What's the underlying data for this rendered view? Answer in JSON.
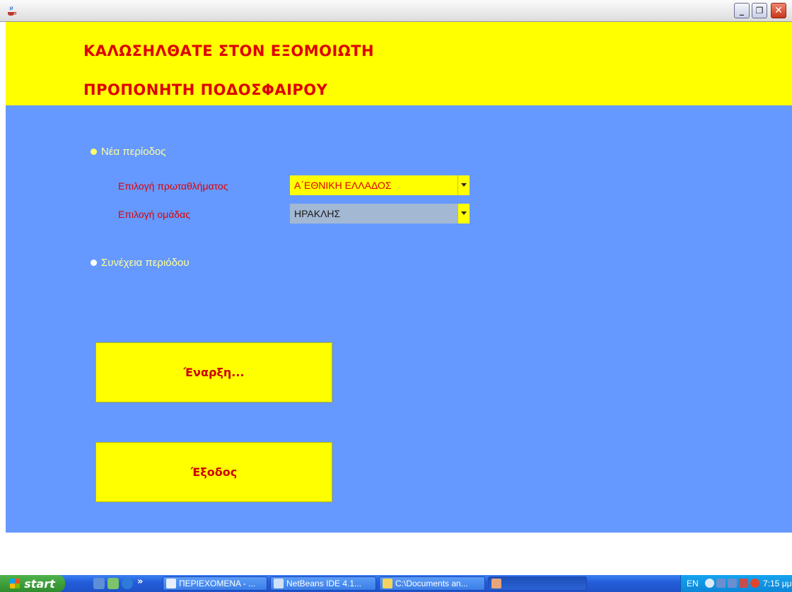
{
  "window": {
    "minimize_symbol": "_",
    "maximize_symbol": "❐",
    "close_symbol": "✕"
  },
  "header": {
    "line1": "ΚΑΛΩΣΗΛΘΑΤΕ ΣΤΟΝ ΕΞΟΜΟΙΩΤΗ",
    "line2": "ΠΡΟΠΟΝΗΤΗ ΠΟΔΟΣΦΑΙΡΟΥ"
  },
  "options": {
    "new_season": "Νέα περίοδος",
    "continue_season": "Συνέχεια περιόδου",
    "selected": "new_season"
  },
  "form": {
    "league_label": "Επιλογή πρωταθλήματος",
    "league_value": "Α΄ΕΘΝΙΚΗ ΕΛΛΑΔΟΣ",
    "team_label": "Επιλογή ομάδας",
    "team_value": "ΗΡΑΚΛΗΣ"
  },
  "buttons": {
    "start": "Έναρξη...",
    "exit": "Έξοδος"
  },
  "taskbar": {
    "start_label": "start",
    "overflow": "»",
    "items": [
      "ΠΕΡΙΕΧΟΜΕΝΑ - ...",
      "NetBeans IDE 4.1...",
      "C:\\Documents an..."
    ],
    "language": "EN",
    "clock": "7:15 μμ"
  },
  "colors": {
    "header_bg": "#ffff00",
    "panel_bg": "#6699ff",
    "accent_red": "#dd0000",
    "radio_text": "#ffff99"
  }
}
